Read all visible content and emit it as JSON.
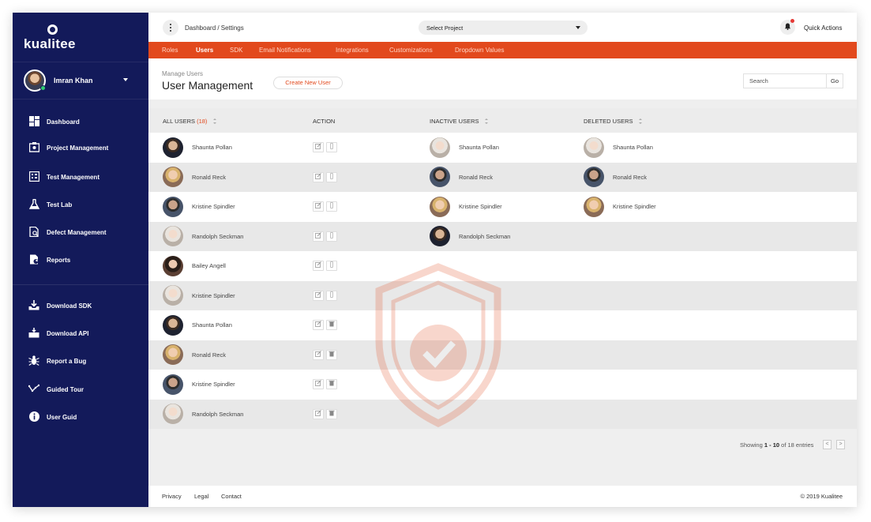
{
  "brand": {
    "name": "kualitee"
  },
  "user": {
    "name": "Imran Khan"
  },
  "sidebar": {
    "items": [
      {
        "label": "Dashboard",
        "icon": "dashboard-icon"
      },
      {
        "label": "Project Management",
        "icon": "project-icon"
      },
      {
        "label": "Test Management",
        "icon": "test-management-icon"
      },
      {
        "label": "Test Lab",
        "icon": "flask-icon"
      },
      {
        "label": "Defect Management",
        "icon": "defect-icon"
      },
      {
        "label": "Reports",
        "icon": "reports-icon"
      }
    ],
    "secondary": [
      {
        "label": "Download SDK",
        "icon": "download-icon"
      },
      {
        "label": "Download API",
        "icon": "api-icon"
      },
      {
        "label": "Report a Bug",
        "icon": "bug-icon"
      },
      {
        "label": "Guided Tour",
        "icon": "tour-icon"
      },
      {
        "label": "User Guid",
        "icon": "info-icon"
      }
    ]
  },
  "header": {
    "breadcrumb": "Dashboard / Settings",
    "project_select": "Select Project",
    "quick_actions": "Quick Actions"
  },
  "tabs": [
    {
      "label": "Roles",
      "active": false
    },
    {
      "label": "Users",
      "active": true
    },
    {
      "label": "SDK",
      "active": false
    },
    {
      "label": "Email Notifications",
      "active": false
    },
    {
      "label": "Integrations",
      "active": false
    },
    {
      "label": "Customizations",
      "active": false
    },
    {
      "label": "Dropdown Values",
      "active": false
    }
  ],
  "page": {
    "subtitle": "Manage Users",
    "title": "User Management",
    "create_button": "Create New User",
    "search_placeholder": "Search",
    "go_button": "Go"
  },
  "table": {
    "columns": {
      "all_users": "ALL USERS",
      "all_users_count": "(18)",
      "action": "ACTION",
      "inactive_users": "INACTIVE USERS",
      "deleted_users": "DELETED USERS"
    },
    "all_users": [
      "Shaunta Pollan",
      "Ronald Reck",
      "Kristine Spindler",
      "Randolph Seckman",
      "Bailey Angell",
      "Kristine Spindler",
      "Shaunta Pollan",
      "Ronald Reck",
      "Kristine Spindler",
      "Randolph Seckman"
    ],
    "inactive_users": [
      "Shaunta Pollan",
      "Ronald Reck",
      "Kristine Spindler",
      "Randolph Seckman"
    ],
    "deleted_users": [
      "Shaunta Pollan",
      "Ronald Reck",
      "Kristine Spindler"
    ]
  },
  "pagination": {
    "prefix": "Showing",
    "range": "1 - 10",
    "suffix": "of 18 entries",
    "prev": "<",
    "next": ">"
  },
  "footer": {
    "links": [
      "Privacy",
      "Legal",
      "Contact"
    ],
    "copyright": "© 2019 Kualitee"
  },
  "colors": {
    "sidebar": "#131a5a",
    "accent": "#e2491d"
  }
}
